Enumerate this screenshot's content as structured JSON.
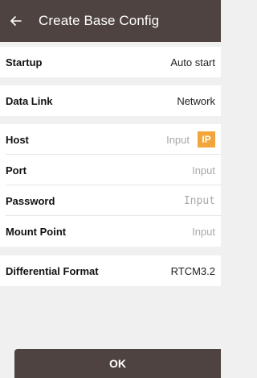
{
  "header": {
    "title": "Create Base Config",
    "back_icon": "back-arrow-icon"
  },
  "sections": {
    "startup": {
      "label": "Startup",
      "value": "Auto start"
    },
    "data_link": {
      "label": "Data Link",
      "value": "Network"
    },
    "network": {
      "host": {
        "label": "Host",
        "placeholder": "Input",
        "badge": "IP"
      },
      "port": {
        "label": "Port",
        "placeholder": "Input"
      },
      "password": {
        "label": "Password",
        "placeholder": "Input"
      },
      "mount_point": {
        "label": "Mount Point",
        "placeholder": "Input"
      }
    },
    "diff_format": {
      "label": "Differential Format",
      "value": "RTCM3.2"
    }
  },
  "footer": {
    "ok_label": "OK"
  },
  "colors": {
    "header_bg": "#4e4341",
    "page_bg": "#f0f0f0",
    "badge_bg": "#f2a53a"
  }
}
